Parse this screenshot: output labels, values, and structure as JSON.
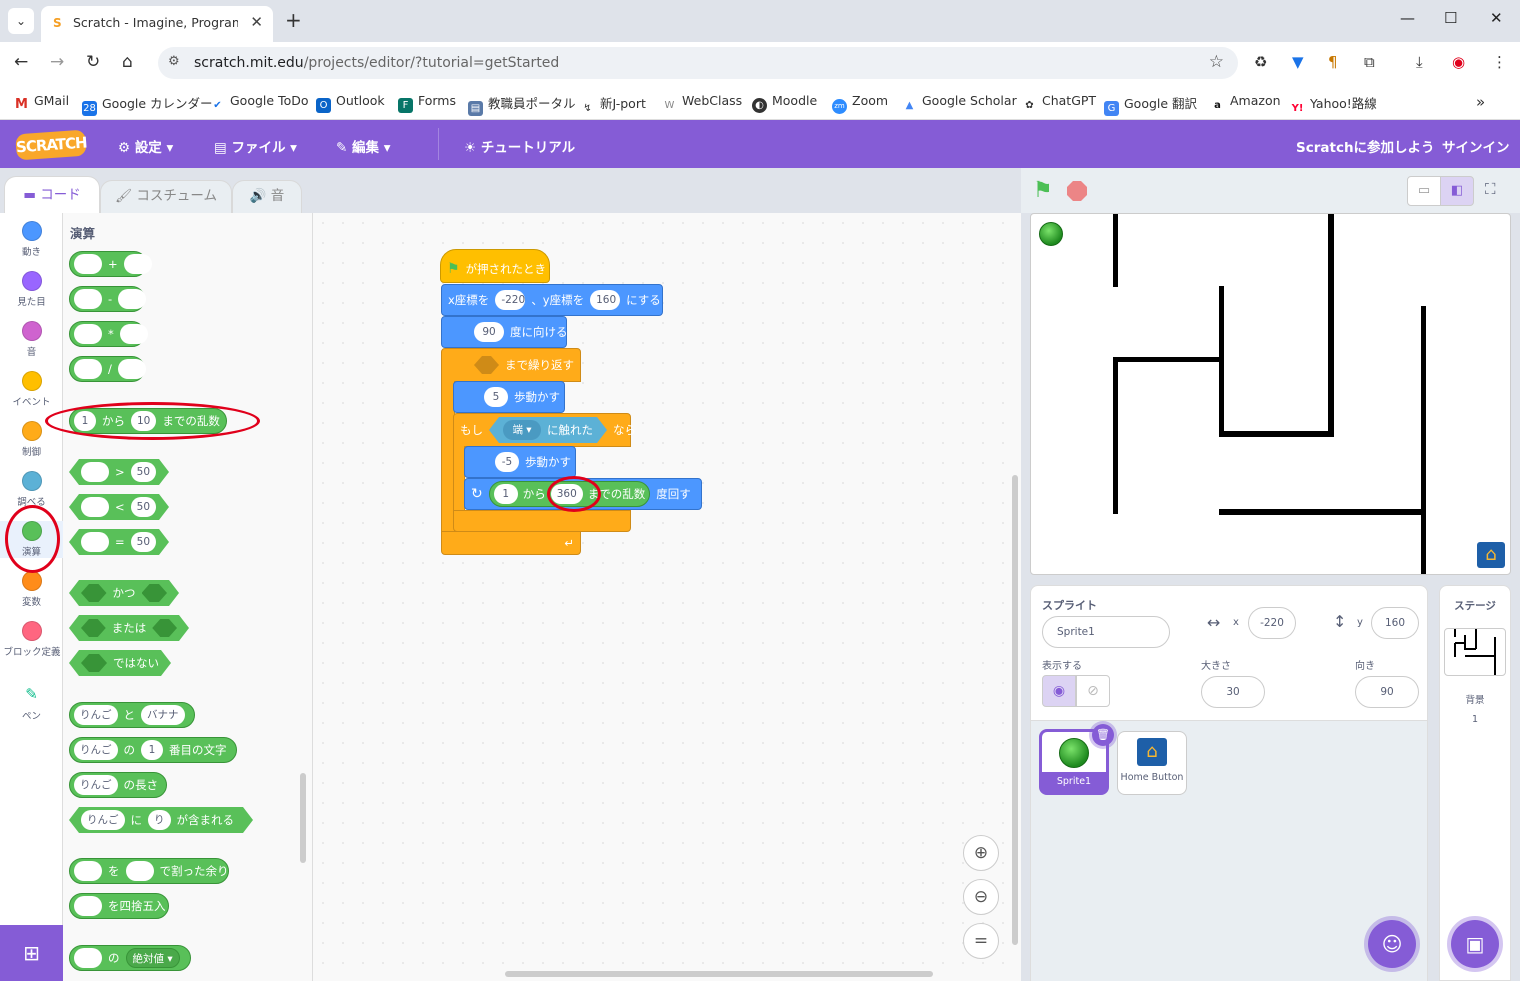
{
  "browser": {
    "tab_title": "Scratch - Imagine, Program, Share",
    "url_host": "scratch.mit.edu",
    "url_path": "/projects/editor/?tutorial=getStarted",
    "bookmarks": [
      "GMail",
      "Google カレンダー",
      "Google ToDo",
      "Outlook",
      "Forms",
      "教職員ポータル",
      "新J-port",
      "WebClass",
      "Moodle",
      "Zoom",
      "Google Scholar",
      "ChatGPT",
      "Google 翻訳",
      "Amazon",
      "Yahoo!路線"
    ]
  },
  "menubar": {
    "logo": "SCRATCH",
    "settings": "設定",
    "file": "ファイル",
    "edit": "編集",
    "tutorials": "チュートリアル",
    "join": "Scratchに参加しよう",
    "signin": "サインイン"
  },
  "tabs": {
    "code": "コード",
    "costumes": "コスチューム",
    "sounds": "音"
  },
  "categories": [
    {
      "label": "動き",
      "color": "#4c97ff"
    },
    {
      "label": "見た目",
      "color": "#9966ff"
    },
    {
      "label": "音",
      "color": "#cf63cf"
    },
    {
      "label": "イベント",
      "color": "#ffbf00"
    },
    {
      "label": "制御",
      "color": "#ffab19"
    },
    {
      "label": "調べる",
      "color": "#5cb1d6"
    },
    {
      "label": "演算",
      "color": "#59c059"
    },
    {
      "label": "変数",
      "color": "#ff8c1a"
    },
    {
      "label": "ブロック定義",
      "color": "#ff6680"
    },
    {
      "label": "ペン",
      "color": "#0fbd8c"
    }
  ],
  "palette": {
    "title": "演算",
    "op_plus": "+",
    "op_minus": "-",
    "op_times": "*",
    "op_div": "/",
    "random_from": "1",
    "random_kara": "から",
    "random_to": "10",
    "random_suffix": "までの乱数",
    "gt": ">",
    "lt": "<",
    "eq": "=",
    "cmp_value": "50",
    "and": "かつ",
    "or": "または",
    "not": "ではない",
    "join_a": "りんご",
    "join_to": "と",
    "join_b": "バナナ",
    "letter_of": "の",
    "letter_idx": "1",
    "letter_suffix": "番目の文字",
    "length_suffix": "の長さ",
    "contains_ni": "に",
    "contains_b": "り",
    "contains_suffix": "が含まれる",
    "mod_wo": "を",
    "mod_suffix": "で割った余り",
    "round_suffix": "を四捨五入",
    "abs_no": "の",
    "abs_fn": "絶対値"
  },
  "script": {
    "hat": "が押されたとき",
    "goto_x_label": "x座標を",
    "goto_x": "-220",
    "goto_y_label": "、y座標を",
    "goto_y": "160",
    "goto_suffix": "にする",
    "point_value": "90",
    "point_suffix": "度に向ける",
    "repeat_until": "まで繰り返す",
    "move_value": "5",
    "move_suffix": "歩動かす",
    "if_label": "もし",
    "touching_target": "端",
    "touching_suffix": "に触れた",
    "if_then": "なら",
    "move_back_value": "-5",
    "move_back_suffix": "歩動かす",
    "turn_from": "1",
    "turn_kara": "から",
    "turn_to": "360",
    "turn_random": "までの乱数",
    "turn_suffix": "度回す"
  },
  "sprite_info": {
    "sprite_label": "スプライト",
    "sprite_name": "Sprite1",
    "x_label": "x",
    "x_value": "-220",
    "y_label": "y",
    "y_value": "160",
    "show_label": "表示する",
    "size_label": "大きさ",
    "size_value": "30",
    "direction_label": "向き",
    "direction_value": "90"
  },
  "sprites": [
    "Sprite1",
    "Home Button"
  ],
  "stage_panel": {
    "title": "ステージ",
    "backdrop_label": "背景",
    "backdrop_count": "1"
  },
  "colors": {
    "accent": "#855cd6",
    "operators": "#59c059",
    "motion": "#4c97ff",
    "control": "#ffab19",
    "events": "#ffbf00",
    "highlight": "#e0001b"
  }
}
